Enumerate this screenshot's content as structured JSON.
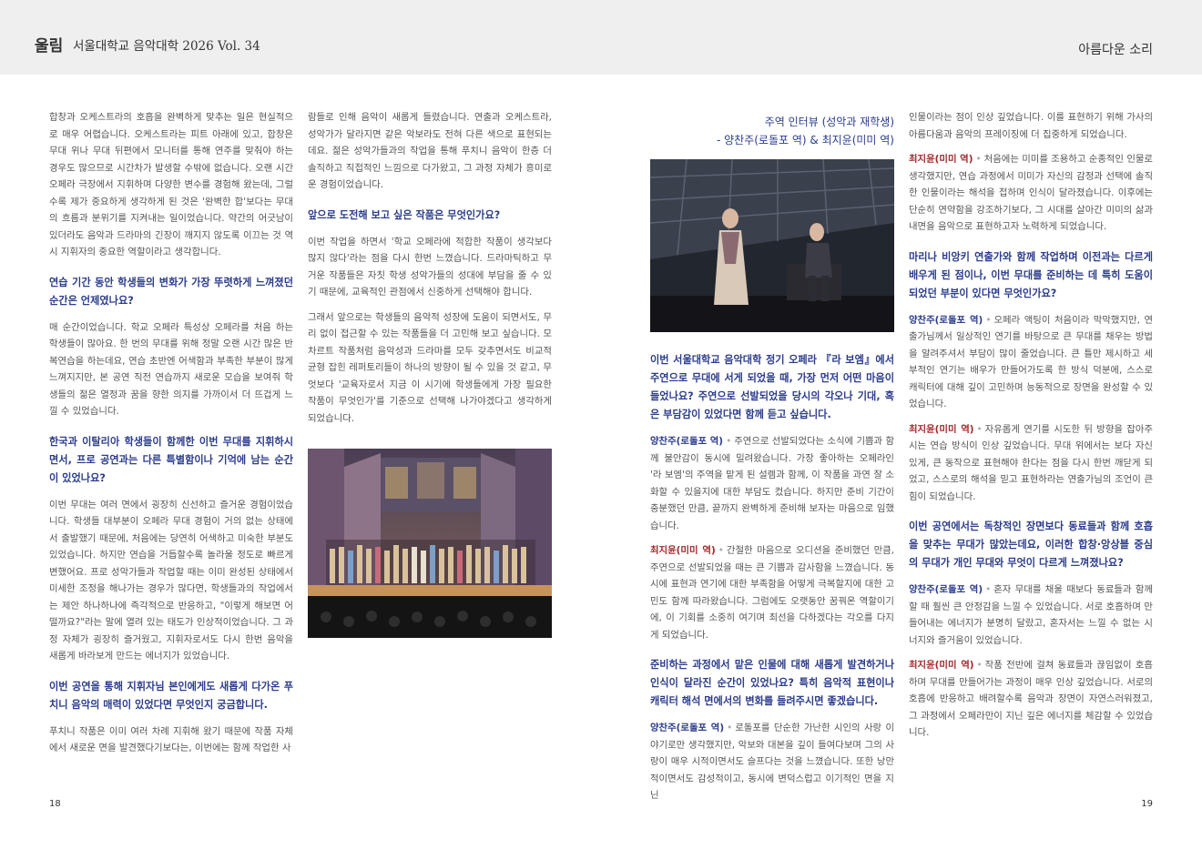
{
  "header": {
    "brand": "울림",
    "publication": "서울대학교 음악대학 2026 Vol. 34",
    "section": "아름다운 소리"
  },
  "pages": {
    "left": "18",
    "right": "19"
  },
  "col1": {
    "p1": "합창과 오케스트라의 호흡을 완벽하게 맞추는 일은 현실적으로 매우 어렵습니다. 오케스트라는 피트 아래에 있고, 합창은 무대 위나 무대 뒤편에서 모니터를 통해 연주를 맞춰야 하는 경우도 많으므로 시간차가 발생할 수밖에 없습니다. 오랜 시간 오페라 극장에서 지휘하며 다양한 변수를 경험해 왔는데, 그럴수록 제가 중요하게 생각하게 된 것은 '완벽한 합'보다는 무대의 흐름과 분위기를 지켜내는 일이었습니다. 약간의 어긋남이 있더라도 음악과 드라마의 긴장이 깨지지 않도록 이끄는 것 역시 지휘자의 중요한 역할이라고 생각합니다.",
    "q1": "연습 기간 동안 학생들의 변화가 가장 뚜렷하게 느껴졌던 순간은 언제였나요?",
    "p2": "매 순간이었습니다. 학교 오페라 특성상 오페라를 처음 하는 학생들이 많아요. 한 번의 무대를 위해 정말 오랜 시간 많은 반복연습을 하는데요, 연습 초반엔 어색함과 부족한 부분이 많게 느껴지지만, 본 공연 직전 연습까지 새로운 모습을 보여줘 학생들의 젊은 열정과 꿈을 향한 의지를 가까이서 더 뜨겁게 느낄 수 있었습니다.",
    "q2": "한국과 이탈리아 학생들이 함께한 이번 무대를 지휘하시면서, 프로 공연과는 다른 특별함이나 기억에 남는 순간이 있었나요?",
    "p3": "이번 무대는 여러 면에서 굉장히 신선하고 즐거운 경험이었습니다. 학생들 대부분이 오페라 무대 경험이 거의 없는 상태에서 출발했기 때문에, 처음에는 당연히 어색하고 미숙한 부분도 있었습니다. 하지만 연습을 거듭할수록 놀라울 정도로 빠르게 변했어요. 프로 성악가들과 작업할 때는 이미 완성된 상태에서 미세한 조정을 해나가는 경우가 많다면, 학생들과의 작업에서는 제안 하나하나에 즉각적으로 반응하고, \"이렇게 해보면 어떨까요?\"라는 말에 열려 있는 태도가 인상적이었습니다. 그 과정 자체가 굉장히 즐거웠고, 지휘자로서도 다시 한번 음악을 새롭게 바라보게 만드는 에너지가 있었습니다.",
    "q3": "이번 공연을 통해 지휘자님 본인에게도 새롭게 다가온 푸치니 음악의 매력이 있었다면 무엇인지 궁금합니다.",
    "p4": "푸치니 작품은 이미 여러 차례 지휘해 왔기 때문에 작품 자체에서 새로운 면을 발견했다기보다는, 이번에는 함께 작업한 사"
  },
  "col2": {
    "p1": "람들로 인해 음악이 새롭게 들렸습니다. 연출과 오케스트라, 성악가가 달라지면 같은 악보라도 전혀 다른 색으로 표현되는데요. 젊은 성악가들과의 작업을 통해 푸치니 음악이 한층 더 솔직하고 직접적인 느낌으로 다가왔고, 그 과정 자체가 흥미로운 경험이었습니다.",
    "q1": "앞으로 도전해 보고 싶은 작품은 무엇인가요?",
    "p2": "이번 작업을 하면서 '학교 오페라에 적합한 작품이 생각보다 많지 않다'라는 점을 다시 한번 느꼈습니다. 드라마틱하고 무거운 작품들은 자칫 학생 성악가들의 성대에 부담을 줄 수 있기 때문에, 교육적인 관점에서 신중하게 선택해야 합니다.",
    "p3": "그래서 앞으로는 학생들의 음악적 성장에 도움이 되면서도, 무리 없이 접근할 수 있는 작품들을 더 고민해 보고 싶습니다. 모차르트 작품처럼 음악성과 드라마를 모두 갖추면서도 비교적 균형 잡힌 레퍼토리들이 하나의 방향이 될 수 있을 것 같고, 무엇보다 '교육자로서 지금 이 시기에 학생들에게 가장 필요한 작품이 무엇인가'를 기준으로 선택해 나가야겠다고 생각하게 되었습니다."
  },
  "col3": {
    "title1": "주역 인터뷰 (성악과 재학생)",
    "title2": "- 양찬주(로돌포 역) & 최지윤(미미 역)",
    "q1": "이번 서울대학교 음악대학 정기 오페라 『라 보엠』에서 주연으로 무대에 서게 되었을 때, 가장 먼저 어떤 마음이 들었나요? 주연으로 선발되었을 당시의 각오나 기대, 혹은 부담감이 있었다면 함께 듣고 싶습니다.",
    "a1_sp": "양찬주(로돌포 역)",
    "a1": "주연으로 선발되었다는 소식에 기쁨과 함께 불안감이 동시에 밀려왔습니다. 가장 좋아하는 오페라인 '라 보엠'의 주역을 맡게 된 설렘과 함께, 이 작품을 과연 잘 소화할 수 있을지에 대한 부담도 컸습니다. 하지만 준비 기간이 충분했던 만큼, 끝까지 완벽하게 준비해 보자는 마음으로 임했습니다.",
    "a2_sp": "최지윤(미미 역)",
    "a2": "간절한 마음으로 오디션을 준비했던 만큼, 주연으로 선발되었을 때는 큰 기쁨과 감사함을 느꼈습니다. 동시에 표현과 연기에 대한 부족함을 어떻게 극복할지에 대한 고민도 함께 따라왔습니다. 그럼에도 오랫동안 꿈꿔온 역할이기에, 이 기회를 소중히 여기며 최선을 다하겠다는 각오를 다지게 되었습니다.",
    "q2": "준비하는 과정에서 맡은 인물에 대해 새롭게 발견하거나 인식이 달라진 순간이 있었나요? 특히 음악적 표현이나 캐릭터 해석 면에서의 변화를 들려주시면 좋겠습니다.",
    "a3_sp": "양찬주(로돌포 역)",
    "a3": "로돌포를 단순한 가난한 시인의 사랑 이야기로만 생각했지만, 악보와 대본을 깊이 들여다보며 그의 사랑이 매우 시적이면서도 슬프다는 것을 느꼈습니다. 또한 낭만적이면서도 감성적이고, 동시에 변덕스럽고 이기적인 면을 지닌"
  },
  "col4": {
    "p1": "인물이라는 점이 인상 깊었습니다. 이를 표현하기 위해 가사의 아름다움과 음악의 프레이징에 더 집중하게 되었습니다.",
    "a1_sp": "최지윤(미미 역)",
    "a1": "처음에는 미미를 조용하고 순종적인 인물로 생각했지만, 연습 과정에서 미미가 자신의 감정과 선택에 솔직한 인물이라는 해석을 접하며 인식이 달라졌습니다. 이후에는 단순히 연약함을 강조하기보다, 그 시대를 살아간 미미의 삶과 내면을 음악으로 표현하고자 노력하게 되었습니다.",
    "q1": "마리나 비앙키 연출가와 함께 작업하며 이전과는 다르게 배우게 된 점이나, 이번 무대를 준비하는 데 특히 도움이 되었던 부분이 있다면 무엇인가요?",
    "a2_sp": "양찬주(로돌포 역)",
    "a2": "오페라 액팅이 처음이라 막막했지만, 연출가님께서 일상적인 연기를 바탕으로 큰 무대를 채우는 방법을 알려주셔서 부담이 많이 줄었습니다. 큰 틀만 제시하고 세부적인 연기는 배우가 만들어가도록 한 방식 덕분에, 스스로 캐릭터에 대해 깊이 고민하며 능동적으로 장면을 완성할 수 있었습니다.",
    "a3_sp": "최지윤(미미 역)",
    "a3": "자유롭게 연기를 시도한 뒤 방향을 잡아주시는 연습 방식이 인상 깊었습니다. 무대 위에서는 보다 자신 있게, 큰 동작으로 표현해야 한다는 점을 다시 한번 깨닫게 되었고, 스스로의 해석을 믿고 표현하라는 연출가님의 조언이 큰 힘이 되었습니다.",
    "q2": "이번 공연에서는 독창적인 장면보다 동료들과 함께 호흡을 맞추는 무대가 많았는데요, 이러한 합창·앙상블 중심의 무대가 개인 무대와 무엇이 다르게 느껴졌나요?",
    "a4_sp": "양찬주(로돌포 역)",
    "a4": "혼자 무대를 채울 때보다 동료들과 함께할 때 훨씬 큰 안정감을 느낄 수 있었습니다. 서로 호흡하며 만들어내는 에너지가 분명히 달랐고, 혼자서는 느낄 수 없는 시너지와 즐거움이 있었습니다.",
    "a5_sp": "최지윤(미미 역)",
    "a5": "작품 전반에 걸쳐 동료들과 끊임없이 호흡하며 무대를 만들어가는 과정이 매우 인상 깊었습니다. 서로의 호흡에 반응하고 배려할수록 음악과 장면이 자연스러워졌고, 그 과정에서 오페라만이 지닌 깊은 에너지를 체감할 수 있었습니다."
  }
}
